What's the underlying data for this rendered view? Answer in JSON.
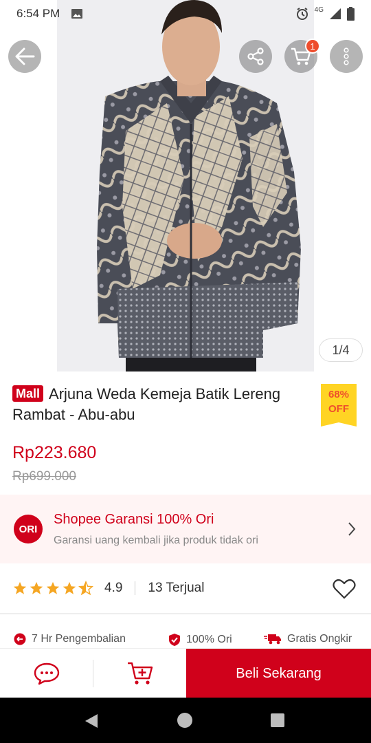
{
  "status_bar": {
    "time": "6:54 PM",
    "network": "4G"
  },
  "header": {
    "cart_count": "1"
  },
  "gallery": {
    "counter": "1/4"
  },
  "product": {
    "mall_label": "Mall",
    "title": "Arjuna Weda Kemeja Batik Lereng Rambat - Abu-abu",
    "discount_percent": "68%",
    "discount_label": "OFF",
    "price": "Rp223.680",
    "original_price": "Rp699.000"
  },
  "guarantee": {
    "icon_text": "ORI",
    "title": "Shopee Garansi 100% Ori",
    "subtitle": "Garansi uang kembali jika produk tidak ori"
  },
  "rating": {
    "value": "4.9",
    "stars": 4.9,
    "sold": "13 Terjual"
  },
  "services": [
    {
      "label": "7 Hr Pengembalian",
      "icon": "return-icon"
    },
    {
      "label": "100% Ori",
      "icon": "shield-check-icon"
    },
    {
      "label": "Gratis Ongkir",
      "icon": "truck-icon"
    }
  ],
  "actions": {
    "buy_now": "Beli Sekarang"
  },
  "colors": {
    "brand_red": "#d0011b",
    "shopee_orange": "#ee4d2d",
    "discount_yellow": "#ffd424"
  }
}
